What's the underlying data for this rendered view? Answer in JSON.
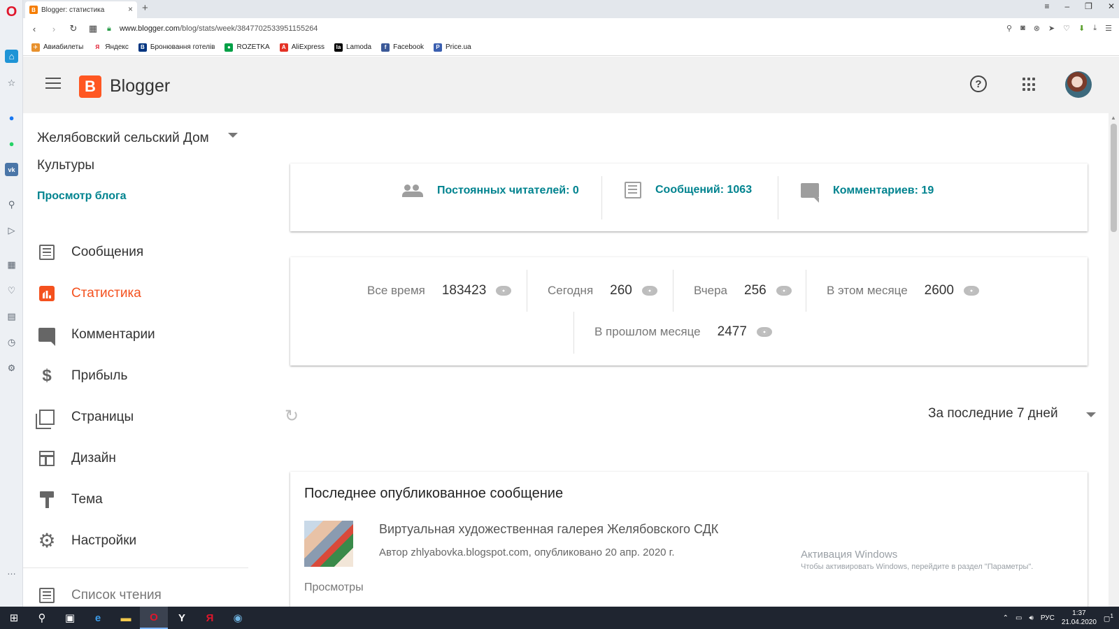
{
  "browser": {
    "tab_title": "Blogger: статистика",
    "tab_favicon": "B",
    "url_prefix": "www.blogger.com",
    "url_path": "/blog/stats/week/3847702533951155264",
    "bookmarks": [
      {
        "label": "Авиабилеты",
        "icon": "plane-icon",
        "color": "#e8912d",
        "glyph": "✈"
      },
      {
        "label": "Яндекс",
        "icon": "yandex-icon",
        "color": "#ffffff",
        "glyph": "Я"
      },
      {
        "label": "Бронювання готелів",
        "icon": "booking-icon",
        "color": "#003580",
        "glyph": "B"
      },
      {
        "label": "ROZETKA",
        "icon": "rozetka-icon",
        "color": "#00a046",
        "glyph": "●"
      },
      {
        "label": "AliExpress",
        "icon": "aliexpress-icon",
        "color": "#e43225",
        "glyph": "A"
      },
      {
        "label": "Lamoda",
        "icon": "lamoda-icon",
        "color": "#000000",
        "glyph": "la"
      },
      {
        "label": "Facebook",
        "icon": "facebook-icon",
        "color": "#3b5998",
        "glyph": "f"
      },
      {
        "label": "Price.ua",
        "icon": "priceua-icon",
        "color": "#3a5fb0",
        "glyph": "P"
      }
    ]
  },
  "header": {
    "app_name": "Blogger",
    "logo_letter": "B"
  },
  "sidebar": {
    "blog_name": "Желябовский сельский Дом Культуры",
    "view_blog": "Просмотр блога",
    "items": [
      {
        "label": "Сообщения",
        "icon": "posts-icon",
        "active": false
      },
      {
        "label": "Статистика",
        "icon": "stats-icon",
        "active": true
      },
      {
        "label": "Комментарии",
        "icon": "comments-icon",
        "active": false
      },
      {
        "label": "Прибыль",
        "icon": "dollar-icon",
        "active": false
      },
      {
        "label": "Страницы",
        "icon": "pages-icon",
        "active": false
      },
      {
        "label": "Дизайн",
        "icon": "layout-icon",
        "active": false
      },
      {
        "label": "Тема",
        "icon": "theme-icon",
        "active": false
      },
      {
        "label": "Настройки",
        "icon": "settings-icon",
        "active": false
      }
    ],
    "partial_item": "Список чтения"
  },
  "summary": {
    "followers": "Постоянных читателей: 0",
    "posts": "Сообщений: 1063",
    "comments": "Комментариев: 19"
  },
  "views": {
    "all_time": {
      "label": "Все время",
      "value": "183423"
    },
    "today": {
      "label": "Сегодня",
      "value": "260"
    },
    "yesterday": {
      "label": "Вчера",
      "value": "256"
    },
    "this_month": {
      "label": "В этом месяце",
      "value": "2600"
    },
    "last_month": {
      "label": "В прошлом месяце",
      "value": "2477"
    }
  },
  "period": {
    "selected": "За последние 7 дней"
  },
  "latest_post": {
    "heading": "Последнее опубликованное сообщение",
    "title": "Виртуальная художественная галерея Желябовского СДК",
    "meta": "Автор zhlyabovka.blogspot.com, опубликовано 20 апр. 2020 г.",
    "views_label": "Просмотры"
  },
  "watermark": {
    "line1": "Активация Windows",
    "line2": "Чтобы активировать Windows, перейдите в раздел \"Параметры\"."
  },
  "taskbar": {
    "language": "РУС",
    "time": "1:37",
    "date": "21.04.2020",
    "notification_count": "1"
  },
  "colors": {
    "accent_teal": "#00838f",
    "active_orange": "#f4511e",
    "blogger_orange": "#ff5722"
  }
}
